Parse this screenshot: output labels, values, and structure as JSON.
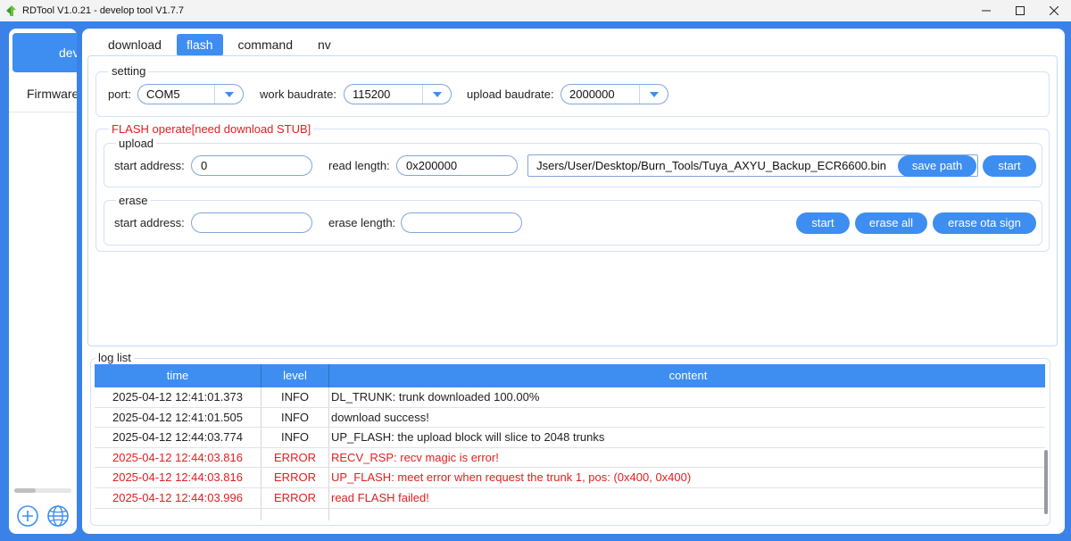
{
  "window": {
    "title": "RDTool V1.0.21 - develop tool V1.7.7"
  },
  "sidebar": {
    "items": [
      {
        "label": "develop tool"
      },
      {
        "label": "Firmware"
      }
    ]
  },
  "tabs": [
    {
      "label": "download"
    },
    {
      "label": "flash"
    },
    {
      "label": "command"
    },
    {
      "label": "nv"
    }
  ],
  "setting": {
    "title": "setting",
    "port_label": "port:",
    "port_value": "COM5",
    "work_baud_label": "work baudrate:",
    "work_baud_value": "115200",
    "upload_baud_label": "upload baudrate:",
    "upload_baud_value": "2000000"
  },
  "flash_operate": {
    "title": "FLASH operate[need download STUB]",
    "upload": {
      "title": "upload",
      "start_address_label": "start address:",
      "start_address_value": "0",
      "read_length_label": "read length:",
      "read_length_value": "0x200000",
      "path_value": "Jsers/User/Desktop/Burn_Tools/Tuya_AXYU_Backup_ECR6600.bin",
      "save_path_label": "save path",
      "start_label": "start"
    },
    "erase": {
      "title": "erase",
      "start_address_label": "start address:",
      "start_address_value": "",
      "erase_length_label": "erase length:",
      "erase_length_value": "",
      "start_label": "start",
      "erase_all_label": "erase all",
      "erase_ota_label": "erase ota sign"
    }
  },
  "log": {
    "title": "log list",
    "columns": [
      "time",
      "level",
      "content"
    ],
    "rows": [
      {
        "time": "2025-04-12 12:41:01.373",
        "level": "INFO",
        "content": "DL_TRUNK: trunk downloaded 100.00%"
      },
      {
        "time": "2025-04-12 12:41:01.505",
        "level": "INFO",
        "content": "download success!"
      },
      {
        "time": "2025-04-12 12:44:03.774",
        "level": "INFO",
        "content": "UP_FLASH: the upload block will slice to 2048 trunks"
      },
      {
        "time": "2025-04-12 12:44:03.816",
        "level": "ERROR",
        "content": "RECV_RSP: recv magic is error!"
      },
      {
        "time": "2025-04-12 12:44:03.816",
        "level": "ERROR",
        "content": "UP_FLASH: meet error when request the trunk 1,  pos: (0x400, 0x400)"
      },
      {
        "time": "2025-04-12 12:44:03.996",
        "level": "ERROR",
        "content": "read FLASH failed!"
      },
      {
        "time": "",
        "level": "",
        "content": ""
      }
    ]
  },
  "colors": {
    "accent": "#3d8ef0",
    "background": "#3b82e8",
    "error": "#e02020"
  },
  "icons": [
    "app-logo-icon",
    "minimize-icon",
    "maximize-icon",
    "close-icon",
    "chevron-down-icon",
    "add-circle-icon",
    "globe-icon"
  ]
}
